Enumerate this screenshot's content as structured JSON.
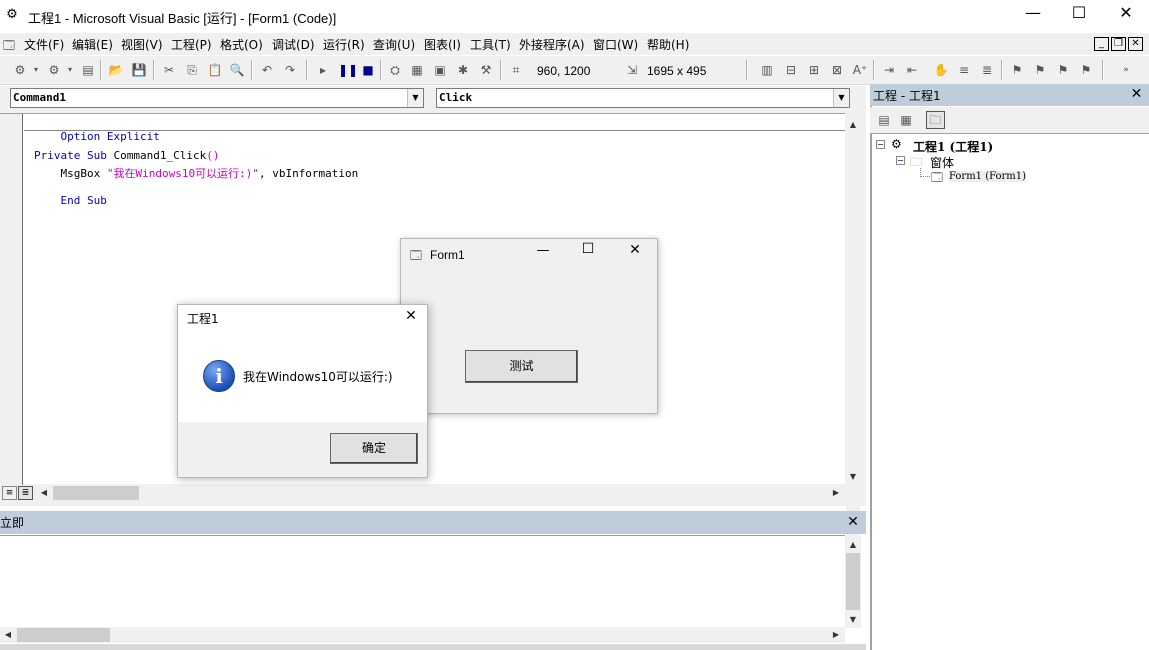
{
  "window": {
    "title": "工程1 - Microsoft Visual Basic [运行] - [Form1 (Code)]",
    "minimize": "—",
    "maximize": "☐",
    "close": "✕"
  },
  "menu": [
    "文件(F)",
    "编辑(E)",
    "视图(V)",
    "工程(P)",
    "格式(O)",
    "调试(D)",
    "运行(R)",
    "查询(U)",
    "图表(I)",
    "工具(T)",
    "外接程序(A)",
    "窗口(W)",
    "帮助(H)"
  ],
  "toolbar": {
    "position": "960, 1200",
    "size": "1695 x 495"
  },
  "code": {
    "object_combo": "Command1",
    "proc_combo": "Click",
    "lines": {
      "l1_kw": "Option Explicit",
      "l2_kw": "Private Sub",
      "l2_rest": " Command1_Click",
      "l2_parens": "()",
      "l3_pre": "    MsgBox ",
      "l3_str": "\"我在Windows10可以运行:)\"",
      "l3_post": ", vbInformation",
      "l4_kw": "End Sub"
    }
  },
  "immediate": {
    "title": "立即"
  },
  "project": {
    "title": "工程 - 工程1",
    "root": "工程1 (工程1)",
    "folder": "窗体",
    "form": "Form1 (Form1)"
  },
  "form1": {
    "title": "Form1",
    "button": "测试"
  },
  "msgbox": {
    "title": "工程1",
    "message": "我在Windows10可以运行:)",
    "ok": "确定"
  }
}
